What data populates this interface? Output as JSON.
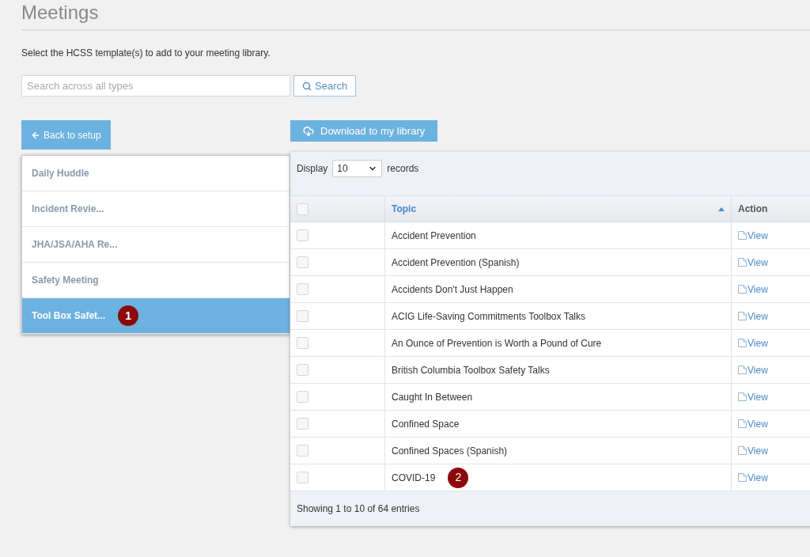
{
  "page": {
    "title": "Meetings",
    "description": "Select the HCSS template(s) to add to your meeting library."
  },
  "search": {
    "placeholder": "Search across all types",
    "button": "Search"
  },
  "back_button": "Back to setup",
  "template_types": [
    {
      "label": "Daily Huddle",
      "selected": false
    },
    {
      "label": "Incident Revie...",
      "selected": false
    },
    {
      "label": "JHA/JSA/AHA Re...",
      "selected": false
    },
    {
      "label": "Safety Meeting",
      "selected": false
    },
    {
      "label": "Tool Box Safet...",
      "selected": true,
      "badge": "1"
    }
  ],
  "download_button": "Download to my library",
  "table": {
    "display_label": "Display",
    "page_size": "10",
    "records_label": "records",
    "header_checked": false,
    "columns": [
      "Topic",
      "Action"
    ],
    "rows": [
      {
        "topic": "Accident Prevention",
        "action": "View",
        "checked": false
      },
      {
        "topic": "Accident Prevention (Spanish)",
        "action": "View",
        "checked": false
      },
      {
        "topic": "Accidents Don't Just Happen",
        "action": "View",
        "checked": false
      },
      {
        "topic": "ACIG Life-Saving Commitments Toolbox Talks",
        "action": "View",
        "checked": false
      },
      {
        "topic": "An Ounce of Prevention is Worth a Pound of Cure",
        "action": "View",
        "checked": false
      },
      {
        "topic": "British Columbia Toolbox Safety Talks",
        "action": "View",
        "checked": false
      },
      {
        "topic": "Caught In Between",
        "action": "View",
        "checked": false
      },
      {
        "topic": "Confined Space",
        "action": "View",
        "checked": false
      },
      {
        "topic": "Confined Spaces (Spanish)",
        "action": "View",
        "checked": false
      },
      {
        "topic": "COVID-19",
        "action": "View",
        "checked": false,
        "badge": "2"
      }
    ],
    "footer": "Showing 1 to 10 of 64 entries"
  }
}
